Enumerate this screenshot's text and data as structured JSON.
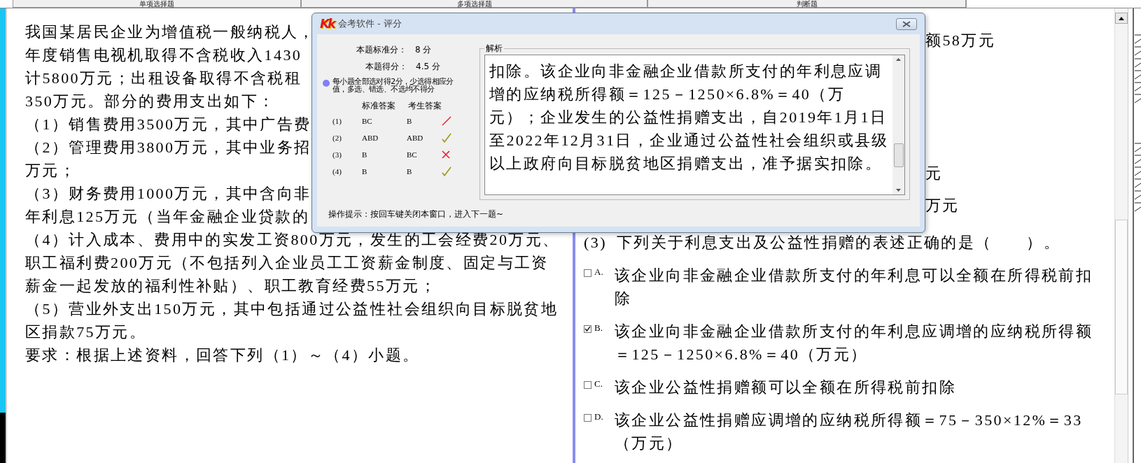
{
  "tabs": [
    {
      "label": "单项选择题"
    },
    {
      "label": "多项选择题"
    },
    {
      "label": "判断题"
    }
  ],
  "material": {
    "lines": [
      "我国某居民企业为增值税一般纳税人，",
      "年度销售电视机取得不含税收入1430",
      "计5800万元；出租设备取得不含税租",
      "350万元。部分的费用支出如下：",
      "（1）销售费用3500万元，其中广告费",
      "（2）管理费用3800万元，其中业务招",
      "万元；",
      "（3）财务费用1000万元，其中含向非",
      "年利息125万元（当年金融企业贷款的",
      "（4）计入成本、费用中的实发工资800万元，发生的工会经费20万元、",
      "职工福利费200万元（不包括列入企业员工工资薪金制度、固定与工资",
      "薪金一起发放的福利性补贴）、职工教育经费55万元；",
      "（5）营业外支出150万元，其中包括通过公益性社会组织向目标脱贫地",
      "区捐款75万元。",
      "要求：根据上述资料，回答下列（1）～（4）小题。"
    ]
  },
  "question": {
    "fragments": [
      "额58万元",
      "元",
      "万元"
    ],
    "number": "(3)",
    "stem": "下列关于利息支出及公益性捐赠的表述正确的是（　　）。",
    "options": [
      {
        "letter": "A.",
        "text": "该企业向非金融企业借款所支付的年利息可以全额在所得税前扣除",
        "checked": false
      },
      {
        "letter": "B.",
        "text": "该企业向非金融企业借款所支付的年利息应调增的应纳税所得额＝125－1250×6.8%＝40（万元）",
        "checked": true
      },
      {
        "letter": "C.",
        "text": "该企业公益性捐赠额可以全额在所得税前扣除",
        "checked": false
      },
      {
        "letter": "D.",
        "text": "该企业公益性捐赠应调增的应纳税所得额＝75－350×12%＝33（万元）",
        "checked": false
      }
    ]
  },
  "dialog": {
    "logo": "Kk",
    "title": "会考软件 - 评分",
    "standard_label": "本题标准分：",
    "standard_score": "8 分",
    "earned_label": "本题得分：",
    "earned_score": "4.5 分",
    "note": "每小题全部选对得2分，少选得相应分值，多选、错选、不选均不得分",
    "headers": [
      "标准答案",
      "考生答案"
    ],
    "results": [
      {
        "number": "(1)",
        "standard": "BC",
        "answer": "B",
        "kind": "partial"
      },
      {
        "number": "(2)",
        "standard": "ABD",
        "answer": "ABD",
        "kind": "correct"
      },
      {
        "number": "(3)",
        "standard": "B",
        "answer": "BC",
        "kind": "wrong"
      },
      {
        "number": "(4)",
        "standard": "B",
        "answer": "B",
        "kind": "correct"
      }
    ],
    "analysis_title": "解析",
    "analysis": "扣除。该企业向非金融企业借款所支付的年利息应调增的应纳税所得额＝125－1250×6.8%＝40（万元）；企业发生的公益性捐赠支出，自2019年1月1日至2022年12月31日，企业通过公益性社会组织或县级以上政府向目标脱贫地区捐赠支出，准予据实扣除。",
    "hint": "操作提示：按回车键关闭本窗口，进入下一题~"
  }
}
